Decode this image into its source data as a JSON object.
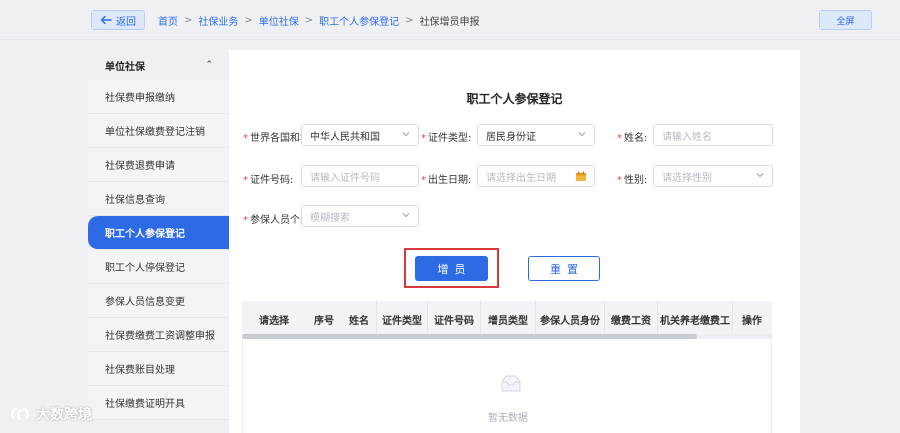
{
  "header": {
    "back_label": "返回",
    "fullscreen_label": "全屏",
    "breadcrumb": [
      "首页",
      "社保业务",
      "单位社保",
      "职工个人参保登记",
      "社保增员申报"
    ],
    "separator": ">"
  },
  "sidebar": {
    "section_title": "单位社保",
    "items": [
      {
        "label": "社保费申报缴纳"
      },
      {
        "label": "单位社保缴费登记注销"
      },
      {
        "label": "社保费退费申请"
      },
      {
        "label": "社保信息查询"
      },
      {
        "label": "职工个人参保登记",
        "active": true
      },
      {
        "label": "职工个人停保登记"
      },
      {
        "label": "参保人员信息变更"
      },
      {
        "label": "社保费缴费工资调整申报"
      },
      {
        "label": "社保费账目处理"
      },
      {
        "label": "社保缴费证明开具"
      }
    ]
  },
  "form": {
    "title": "职工个人参保登记",
    "fields": {
      "country": {
        "label": "世界各国和地",
        "value": "中华人民共和国"
      },
      "id_type": {
        "label": "证件类型:",
        "value": "居民身份证"
      },
      "name": {
        "label": "姓名:",
        "placeholder": "请输入姓名"
      },
      "id_number": {
        "label": "证件号码:",
        "placeholder": "请输入证件号码"
      },
      "birth_date": {
        "label": "出生日期:",
        "placeholder": "请选择出生日期"
      },
      "gender": {
        "label": "性别:",
        "placeholder": "请选择性别"
      },
      "person_type": {
        "label": "参保人员个人",
        "placeholder": "模糊搜索"
      }
    },
    "required_mark": "*",
    "add_button": "增员",
    "reset_button": "重置"
  },
  "table": {
    "columns": [
      "请选择",
      "序号",
      "姓名",
      "证件类型",
      "证件号码",
      "增员类型",
      "参保人员身份",
      "缴费工资",
      "机关养老缴费工",
      "操作"
    ],
    "empty_text": "暂无数据"
  },
  "watermark": {
    "text": "大数跨境"
  },
  "colors": {
    "primary": "#2d6be4",
    "highlight": "#d8393a",
    "required": "#e3433f"
  }
}
